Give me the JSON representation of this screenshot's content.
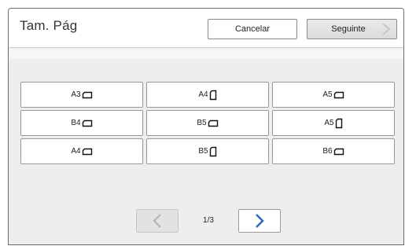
{
  "header": {
    "title": "Tam. Pág",
    "cancel_label": "Cancelar",
    "next_label": "Seguinte"
  },
  "sizes": [
    {
      "label": "A3",
      "orientation": "landscape"
    },
    {
      "label": "A4",
      "orientation": "portrait"
    },
    {
      "label": "A5",
      "orientation": "landscape"
    },
    {
      "label": "B4",
      "orientation": "landscape"
    },
    {
      "label": "B5",
      "orientation": "landscape"
    },
    {
      "label": "A5",
      "orientation": "portrait"
    },
    {
      "label": "A4",
      "orientation": "landscape"
    },
    {
      "label": "B5",
      "orientation": "portrait"
    },
    {
      "label": "B6",
      "orientation": "landscape"
    }
  ],
  "pager": {
    "page_indicator": "1/3"
  },
  "icons": {
    "next_chevron": "chevron-right-icon",
    "prev_page": "chevron-left-icon",
    "next_page": "chevron-right-icon",
    "landscape": "paper-landscape-icon",
    "portrait": "paper-portrait-icon"
  },
  "colors": {
    "accent_blue": "#2e6bb5",
    "disabled_gray": "#b5b5b5"
  }
}
